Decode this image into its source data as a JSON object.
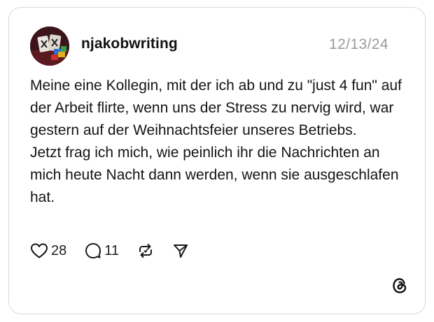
{
  "post": {
    "username": "njakobwriting",
    "date": "12/13/24",
    "paragraphs": [
      "Meine eine Kollegin, mit der ich ab und zu \"just 4 fun\" auf der Arbeit flirte, wenn uns der Stress zu nervig wird, war gestern auf der Weihnachtsfeier unseres Betriebs.",
      "Jetzt frag ich mich, wie peinlich ihr die Nachrichten an mich heute Nacht dann werden, wenn sie ausgeschlafen hat."
    ]
  },
  "actions": {
    "likes": {
      "icon": "heart-icon",
      "count": "28"
    },
    "comments": {
      "icon": "comment-icon",
      "count": "11"
    },
    "repost": {
      "icon": "repost-icon"
    },
    "share": {
      "icon": "send-icon"
    }
  },
  "branding": {
    "icon": "threads-logo-icon"
  },
  "colors": {
    "border": "#d9d9d9",
    "date_text": "#9a9a9a",
    "body_text": "#141414"
  }
}
